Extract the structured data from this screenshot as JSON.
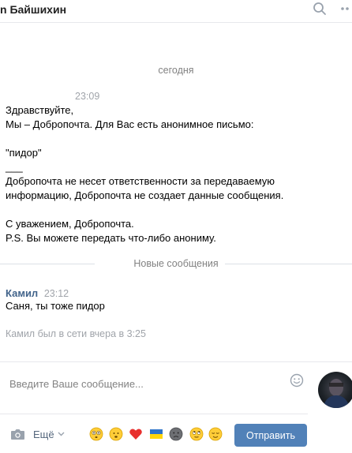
{
  "header": {
    "title": "n Байшихин"
  },
  "date_separator": "сегодня",
  "messages": [
    {
      "time": "23:09",
      "lines": [
        "Здравствуйте,",
        "Мы – Добропочта. Для Вас есть анонимное письмо:",
        "\"пидор\"",
        "___",
        "Добропочта не несет ответственности за передаваемую",
        "информацию, Добропочта не создает данные сообщения.",
        "С уважением, Добропочта.",
        "P.S. Вы можете передать что-либо анониму."
      ]
    },
    {
      "author": "Камил",
      "time": "23:12",
      "text": "Саня, ты тоже пидор"
    }
  ],
  "new_messages_divider": "Новые сообщения",
  "status": "Камил был в сети вчера в 3:25",
  "composer": {
    "placeholder": "Введите Ваше сообщение...",
    "more_label": "Ещё",
    "send_label": "Отправить"
  },
  "icons": {
    "header": [
      "search-icon",
      "more-icon"
    ],
    "composer": [
      "smile-icon",
      "camera-icon",
      "chevron-down-icon"
    ],
    "emoji": [
      "flushed",
      "neutral-face",
      "heart",
      "ukraine-flag",
      "sad-face",
      "rolling-eyes",
      "relieved"
    ]
  },
  "colors": {
    "accent": "#5181b8",
    "author": "#42648b",
    "muted": "#828282"
  }
}
